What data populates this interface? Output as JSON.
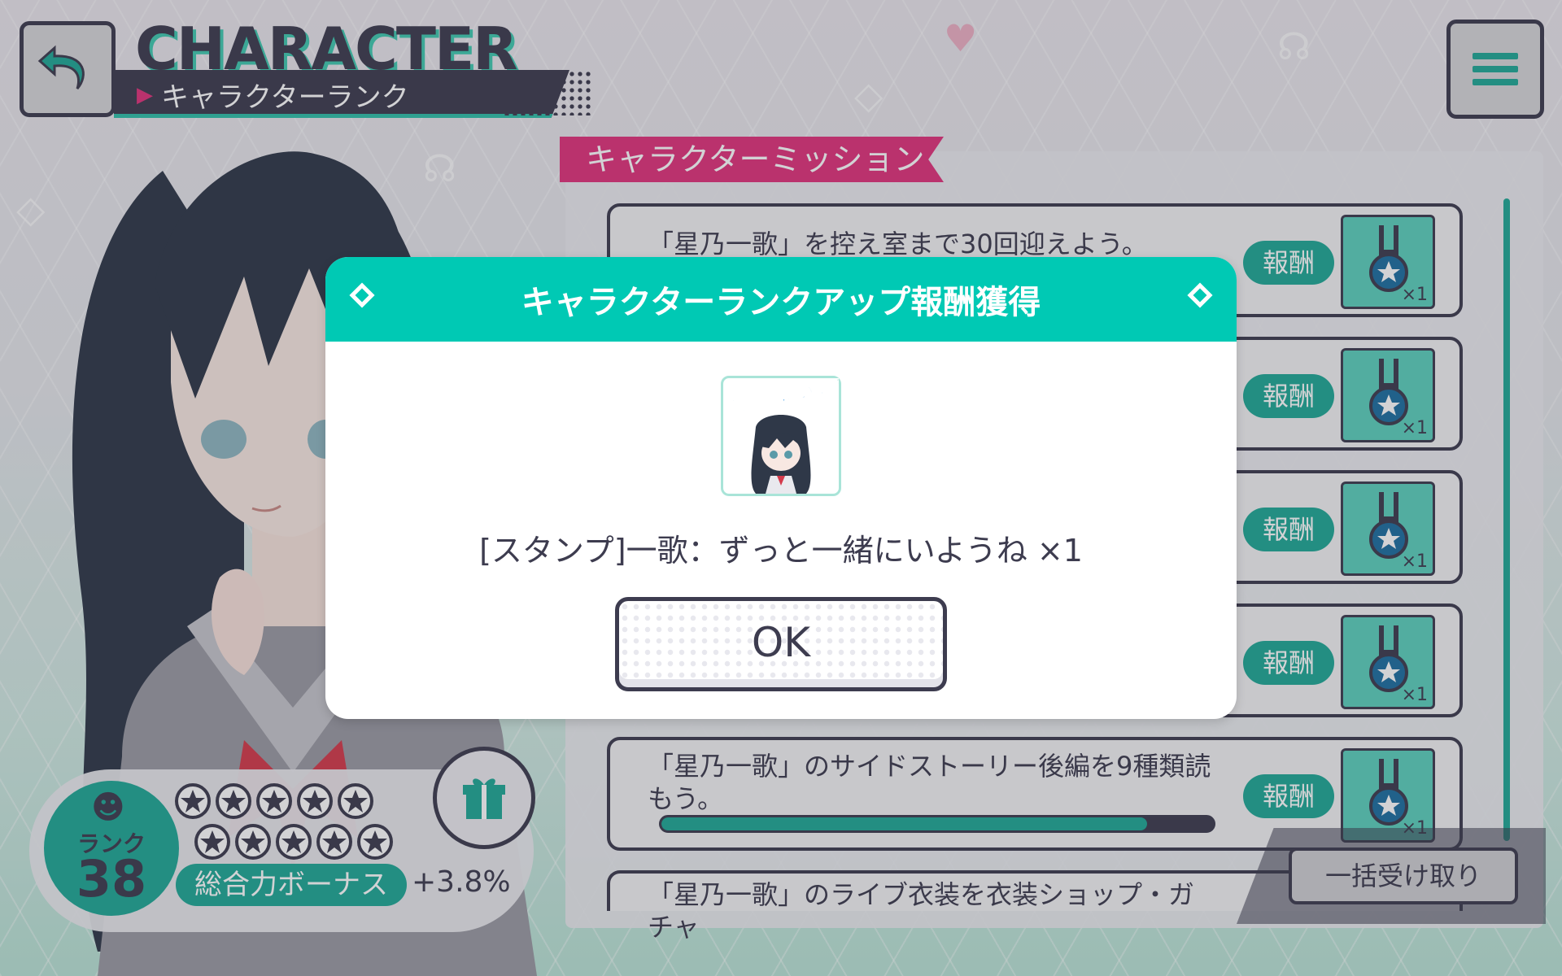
{
  "header": {
    "title": "CHARACTER",
    "subtitle": "キャラクターランク",
    "back_icon": "back-arrow-icon",
    "menu_icon": "hamburger-menu-icon"
  },
  "missions": {
    "tab_label": "キャラクターミッション",
    "reward_label": "報酬",
    "items": [
      {
        "text": "「星乃一歌」を控え室まで30回迎えよう。",
        "qty": "×1"
      },
      {
        "text": "",
        "qty": "×1"
      },
      {
        "text": "",
        "qty": "×1"
      },
      {
        "text": "",
        "qty": "×1"
      },
      {
        "text": "「星乃一歌」のサイドストーリー後編を9種類読もう。",
        "qty": "×1",
        "progress": 0.88
      },
      {
        "text": "「星乃一歌」のライブ衣装を衣装ショップ・ガチャ"
      }
    ],
    "bulk_button": "一括受け取り"
  },
  "rank": {
    "label": "ランク",
    "value": "38",
    "stars_filled": 0,
    "stars_total": 10,
    "bonus_label": "総合力ボーナス",
    "bonus_value": "+3.8%"
  },
  "dialog": {
    "title": "キャラクターランクアップ報酬獲得",
    "stamp_text": "ずっと一緒にいようね",
    "reward_text": "[スタンプ]一歌：ずっと一緒にいようね ×1",
    "ok_label": "OK"
  },
  "colors": {
    "teal": "#00c9b4",
    "dark": "#3d3c4f",
    "pink": "#e0337c",
    "reward_green": "#1fa896"
  }
}
